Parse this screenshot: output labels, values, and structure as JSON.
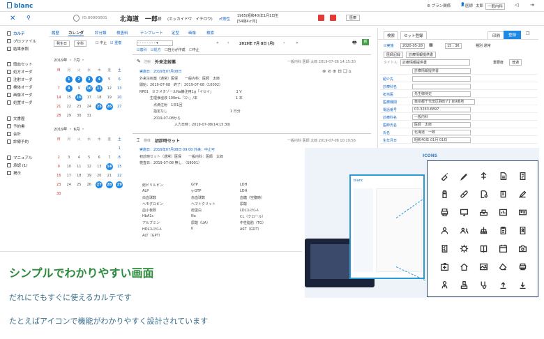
{
  "app": {
    "logo": "blanc"
  },
  "topbar": {
    "pref": "プラン関係",
    "user": "医師",
    "user2": "太郎",
    "dept": "一般内科"
  },
  "patient": {
    "id": "ID:00000001",
    "name": "北海道　一郎",
    "suffix": "様",
    "kana": "(ホッカイドウ　イチロウ)",
    "sex": "♂男性",
    "dob": "1965(昭和40)年1月1日生",
    "age": "[54歳4ヶ月]",
    "select": "医療"
  },
  "sidebar": {
    "items": [
      {
        "label": "カルテ",
        "active": true
      },
      {
        "label": "プロファイル"
      },
      {
        "label": "結果参照"
      },
      {
        "label": "頭血セット"
      },
      {
        "label": "処方オーダ"
      },
      {
        "label": "注射オーダ"
      },
      {
        "label": "検体オーダ"
      },
      {
        "label": "画像オーダ"
      },
      {
        "label": "処置オーダ"
      },
      {
        "label": "文書歴"
      },
      {
        "label": "予約書"
      },
      {
        "label": "会計"
      },
      {
        "label": "診療予約"
      },
      {
        "label": "マニュアル"
      },
      {
        "label": "承認 (1)"
      },
      {
        "label": "掲示"
      }
    ]
  },
  "tabs": [
    "履歴",
    "カレンダ",
    "診分類",
    "検査料",
    "テンプレート",
    "定型",
    "画像",
    "検索"
  ],
  "calendar": {
    "filter1": "発生日",
    "filter2": "全科",
    "chk1": "中止",
    "chk2": "重複",
    "weekdays": [
      "日",
      "月",
      "火",
      "水",
      "木",
      "金",
      "土"
    ],
    "months": [
      {
        "title": "2019年 ・ 7月 ・",
        "marked": [
          1,
          2,
          3,
          4,
          8,
          10,
          11,
          16,
          25,
          26
        ]
      },
      {
        "title": "2019年 ・ 6月 ・",
        "marked": [
          14,
          27,
          28,
          29
        ]
      }
    ]
  },
  "center": {
    "date": "2019年 7月 8日 (月)",
    "filters": [
      "患科",
      "処方",
      "自分が作成",
      "中止"
    ],
    "entries": [
      {
        "icon": "pen",
        "title": "外来注射薬",
        "right": "一般内科 医師 太郎 2019-07-08 14:15:30",
        "lines": [
          "実施日：2019年07月08日",
          "外来注射薬（通常）医保　　一般内科：医師　太郎",
          "開始：2019-07-08　終了：2019-07-08（10002）",
          "RP01　セフメタゾールNa静注用1g「イセイ」　　　　　　　1 V",
          "　　　生理食塩液 100mL「ｺﾌｰ」/本　　　　　　　　　　　1 本",
          "　　　　点滴注射　1日1回",
          "　　　　指定なし　　　　　　　　　　　　　　　　　　1 日分",
          "　　　　2019-07-08から",
          "　　　　　　　　　　入力日時：2019-07-08(14:15:30)"
        ]
      },
      {
        "icon": "tube",
        "title": "初診時セット",
        "right": "一般内科 医師 太郎 2019-07-08 10:19:56",
        "lines": [
          "実施日：2019年07月08日 09:00 外来：中止可",
          "初診時セット（通常）医保　　一般内科：医師　太郎",
          "検査日：2019-07-08 無し　（S8001）"
        ]
      }
    ],
    "labs": [
      [
        "総ビリルビン",
        "GTP",
        "LDH"
      ],
      [
        "ALP",
        "γ-GTP",
        "LDH"
      ],
      [
        "白血球数",
        "赤血球数",
        "血糖（空腹時）"
      ],
      [
        "ヘモグロビン",
        "ヘマトクリット",
        "尿酸"
      ],
      [
        "血小板数",
        "総蛋白",
        "LDLｺﾚｽﾃﾛｰﾙ"
      ],
      [
        "HbA1c",
        "Na",
        "CL（クロール）"
      ],
      [
        "アルブミン",
        "尿酸（UA）",
        "中性脂肪（TG）"
      ],
      [
        "HDLｺﾚｽﾃﾛｰﾙ",
        "K",
        "AST（GOT）"
      ],
      [
        "ALT（GPT）",
        "",
        ""
      ]
    ]
  },
  "right": {
    "tabs": [
      "検索",
      "セット登録"
    ],
    "print": "印刷",
    "register": "登録",
    "date": "2020-05-28",
    "time": "15 : 36",
    "kind": "通常",
    "doc": "医師記録",
    "docsub": "診療情報提供書",
    "title_label": "タイトル",
    "title_val": "診療情報提供書",
    "priority_label": "重要度",
    "priority_val": "普通",
    "rows": [
      {
        "label": "",
        "value": "診療情報提供書"
      },
      {
        "label": "紹介先",
        "value": ""
      },
      {
        "label": "診療科名",
        "value": ""
      },
      {
        "label": "担当医",
        "value": "先生御侍史"
      },
      {
        "label": "医療機関",
        "value": "東京都千代田区麹町7丁目9番地"
      },
      {
        "label": "電話番号",
        "value": "03-3263-6897"
      },
      {
        "label": "診療科名",
        "value": "一般内科"
      },
      {
        "label": "医師氏名",
        "value": "医師　太郎"
      },
      {
        "label": "氏名",
        "value": "北海道　一郎"
      },
      {
        "label": "生年月日",
        "value": "昭和40年 01月 01日"
      }
    ],
    "hospital": "プラン病院",
    "sex": "男"
  },
  "icons": {
    "title": "ICONS",
    "names": [
      "injection-icon",
      "pen-icon",
      "branch-icon",
      "document-icon",
      "document-lines-icon",
      "pill-bottle-icon",
      "capsule-icon",
      "document-search-icon",
      "note-icon",
      "edit-icon",
      "printer-icon",
      "monitor-icon",
      "tray-icon",
      "chart-box-icon",
      "id-card-icon",
      "person-icon",
      "group-icon",
      "network-icon",
      "clipboard-icon",
      "person-badge-icon",
      "checklist-icon",
      "virus-icon",
      "book-icon",
      "calendar-icon",
      "camera-icon",
      "medical-box-icon",
      "home-icon",
      "image-icon",
      "eraser-icon",
      "printer-small-icon",
      "doctor-icon",
      "stamp-icon",
      "stethoscope-icon",
      "upload-icon",
      "download-icon"
    ]
  },
  "headline": {
    "title": "シンプルでわかりやすい画面",
    "sub1": "だれにでもすぐに使えるカルテです",
    "sub2": "たとえばアイコンで機能がわかりやすく設計されています"
  }
}
